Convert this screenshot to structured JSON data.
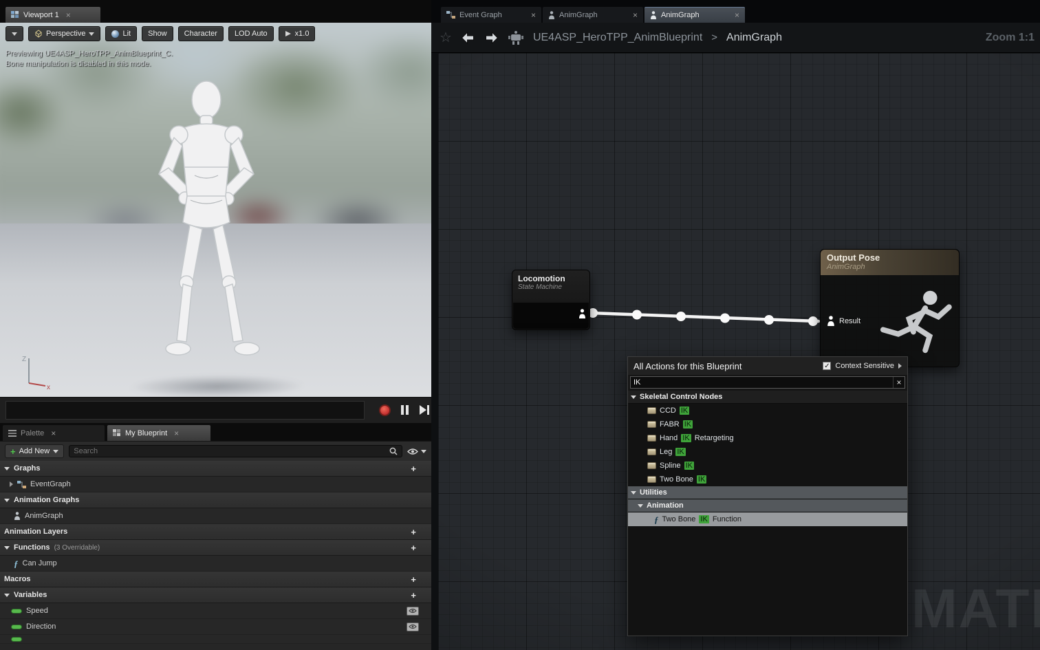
{
  "icons": {
    "close": "×",
    "check": "✓",
    "star": "☆",
    "plus": "+",
    "function_f": "ƒ"
  },
  "viewport": {
    "tab_label": "Viewport 1",
    "toolbar": {
      "perspective": "Perspective",
      "lit": "Lit",
      "show": "Show",
      "character": "Character",
      "lod_auto": "LOD Auto",
      "playback_speed": "x1.0"
    },
    "overlay_line1": "Previewing UE4ASP_HeroTPP_AnimBlueprint_C.",
    "overlay_line2": "Bone manipulation is disabled in this mode.",
    "axis_z": "Z",
    "axis_x": "x"
  },
  "my_blueprint": {
    "tab_palette": "Palette",
    "tab_my_blueprint": "My Blueprint",
    "add_new": "Add New",
    "search_placeholder": "Search",
    "rows": {
      "graphs": "Graphs",
      "event_graph": "EventGraph",
      "animation_graphs": "Animation Graphs",
      "anim_graph": "AnimGraph",
      "animation_layers": "Animation Layers",
      "functions": "Functions",
      "functions_note": "(3 Overridable)",
      "can_jump": "Can Jump",
      "macros": "Macros",
      "variables": "Variables",
      "speed": "Speed",
      "direction": "Direction"
    }
  },
  "graph": {
    "tabs": [
      {
        "label": "Event Graph"
      },
      {
        "label": "AnimGraph"
      },
      {
        "label": "AnimGraph"
      }
    ],
    "breadcrumb_root": "UE4ASP_HeroTPP_AnimBlueprint",
    "breadcrumb_sep": ">",
    "breadcrumb_current": "AnimGraph",
    "zoom_label": "Zoom 1:1",
    "locomotion_title": "Locomotion",
    "locomotion_subtitle": "State Machine",
    "output_pose_title": "Output Pose",
    "output_pose_subtitle": "AnimGraph",
    "result_pin": "Result",
    "watermark": "MATION"
  },
  "context_menu": {
    "title": "All Actions for this Blueprint",
    "context_sensitive": "Context Sensitive",
    "search_value": "IK",
    "cat_skeletal": "Skeletal Control Nodes",
    "items": [
      {
        "pre": "CCD",
        "hl": "IK",
        "post": ""
      },
      {
        "pre": "FABR",
        "hl": "IK",
        "post": ""
      },
      {
        "pre": "Hand ",
        "hl": "IK",
        "post": " Retargeting"
      },
      {
        "pre": "Leg ",
        "hl": "IK",
        "post": ""
      },
      {
        "pre": "Spline ",
        "hl": "IK",
        "post": ""
      },
      {
        "pre": "Two Bone ",
        "hl": "IK",
        "post": ""
      }
    ],
    "cat_utilities": "Utilities",
    "cat_animation": "Animation",
    "selected_item": {
      "pre": "Two Bone ",
      "hl": "IK",
      "post": " Function"
    }
  }
}
